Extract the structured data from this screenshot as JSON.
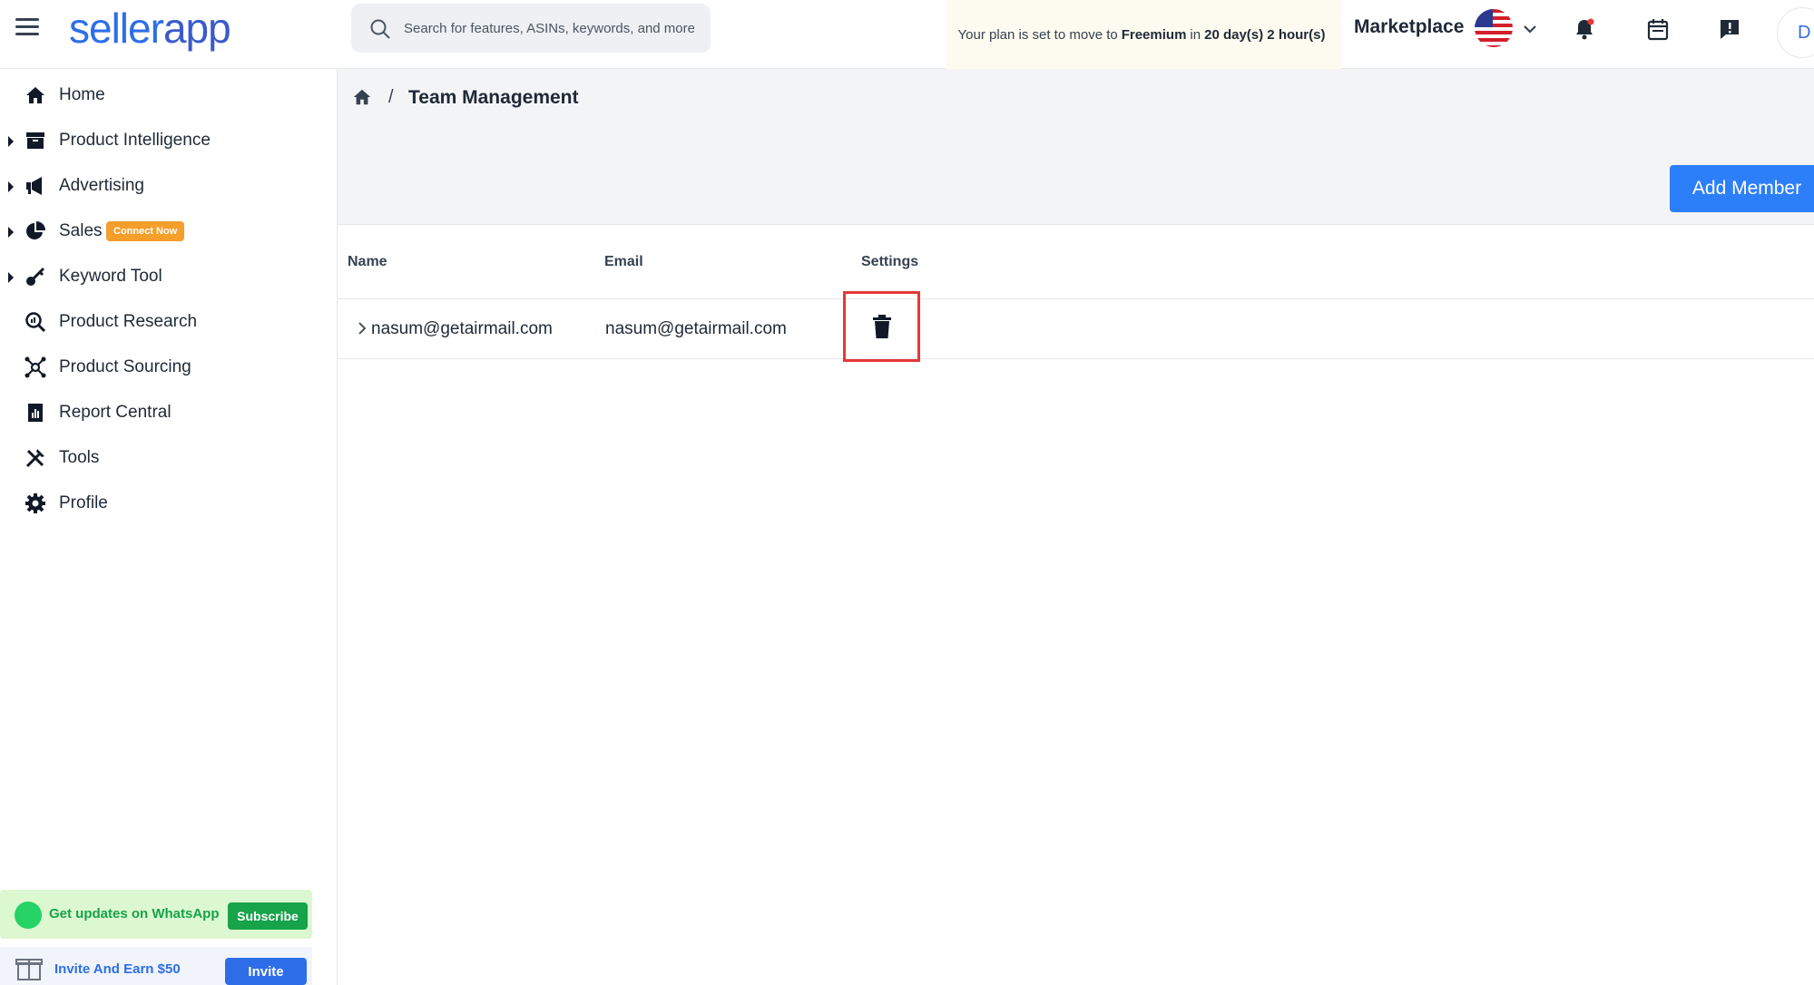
{
  "header": {
    "logo_part1": "seller",
    "logo_part2": "app",
    "search_placeholder": "Search for features, ASINs, keywords, and more",
    "plan_prefix": "Your plan is set to move to",
    "plan_name": "Freemium",
    "plan_mid": "in",
    "plan_time": "20 day(s) 2 hour(s)",
    "marketplace_label": "Marketplace",
    "avatar_initial": "D"
  },
  "sidebar": {
    "items": [
      {
        "label": "Home",
        "icon": "home-icon"
      },
      {
        "label": "Product Intelligence",
        "icon": "archive-icon"
      },
      {
        "label": "Advertising",
        "icon": "megaphone-icon"
      },
      {
        "label": "Sales",
        "icon": "pie-chart-icon",
        "badge": "Connect Now"
      },
      {
        "label": "Keyword Tool",
        "icon": "key-icon"
      },
      {
        "label": "Product Research",
        "icon": "search-analytics-icon"
      },
      {
        "label": "Product Sourcing",
        "icon": "network-icon"
      },
      {
        "label": "Report Central",
        "icon": "report-icon"
      },
      {
        "label": "Tools",
        "icon": "tools-icon"
      },
      {
        "label": "Profile",
        "icon": "gear-icon"
      }
    ],
    "whatsapp_text": "Get updates on WhatsApp",
    "subscribe_label": "Subscribe",
    "invite_text": "Invite And Earn $50",
    "invite_label": "Invite"
  },
  "main": {
    "breadcrumb_title": "Team Management",
    "breadcrumb_sep": "/",
    "add_member_label": "Add Member",
    "columns": [
      "Name",
      "Email",
      "Settings"
    ],
    "rows": [
      {
        "name": "nasum@getairmail.com",
        "email": "nasum@getairmail.com"
      }
    ]
  },
  "colors": {
    "brand": "#2d6ee8",
    "accent_button": "#2d7ff9",
    "badge": "#f59e2a",
    "highlight_border": "#e53935",
    "whatsapp_green": "#16a34a"
  }
}
